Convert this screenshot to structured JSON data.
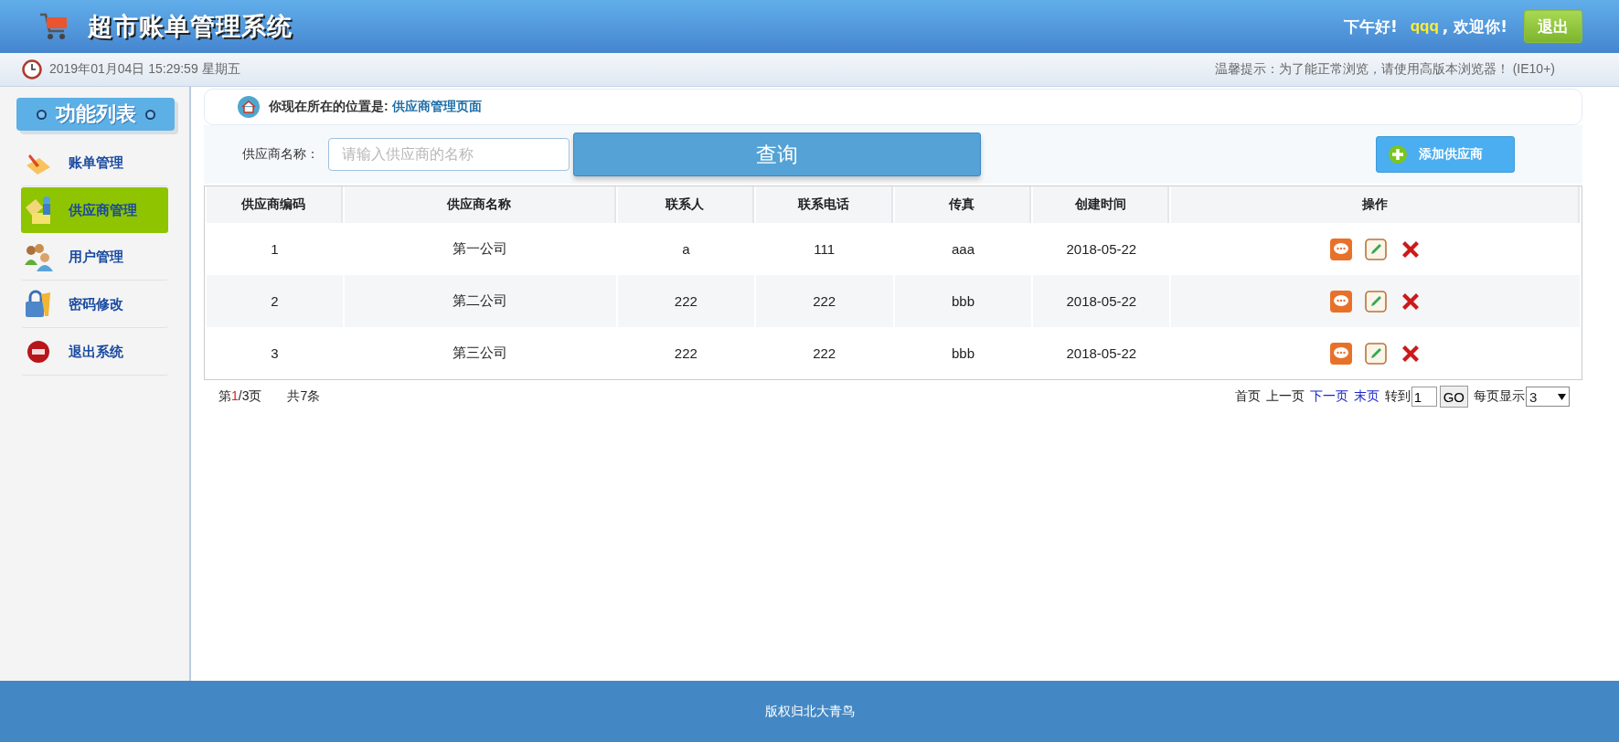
{
  "header": {
    "title": "超市账单管理系统",
    "greeting": "下午好!",
    "username": "qqq",
    "welcome": ", 欢迎你!",
    "logout_button": "退出"
  },
  "info_bar": {
    "datetime": "2019年01月04日 15:29:59 星期五",
    "notice": "温馨提示：为了能正常浏览，请使用高版本浏览器！ (IE10+)"
  },
  "sidebar": {
    "title": "功能列表",
    "items": [
      {
        "kind": "bill",
        "label": "账单管理",
        "selected": false
      },
      {
        "kind": "supplier",
        "label": "供应商管理",
        "selected": true
      },
      {
        "kind": "user",
        "label": "用户管理",
        "selected": false
      },
      {
        "kind": "password",
        "label": "密码修改",
        "selected": false
      },
      {
        "kind": "exit",
        "label": "退出系统",
        "selected": false
      }
    ]
  },
  "breadcrumb": {
    "label": "你现在所在的位置是:",
    "location": "供应商管理页面"
  },
  "search": {
    "label": "供应商名称：",
    "placeholder": "请输入供应商的名称",
    "button": "查询",
    "add_button": "添加供应商"
  },
  "table": {
    "columns": [
      "供应商编码",
      "供应商名称",
      "联系人",
      "联系电话",
      "传真",
      "创建时间",
      "操作"
    ],
    "rows": [
      [
        "1",
        "第一公司",
        "a",
        "111",
        "aaa",
        "2018-05-22"
      ],
      [
        "2",
        "第二公司",
        "222",
        "222",
        "bbb",
        "2018-05-22"
      ],
      [
        "3",
        "第三公司",
        "222",
        "222",
        "bbb",
        "2018-05-22"
      ]
    ]
  },
  "pagination": {
    "page_prefix": "第",
    "current_page": "1",
    "page_suffix": "/3页",
    "total": "共7条",
    "links": [
      {
        "label": "首页",
        "enabled": false
      },
      {
        "label": "上一页",
        "enabled": false
      },
      {
        "label": "下一页",
        "enabled": true
      },
      {
        "label": "末页",
        "enabled": true
      }
    ],
    "jump_label": "转到",
    "jump_value": "1",
    "go_button": "GO",
    "page_size_label": "每页显示",
    "page_size": "3"
  },
  "footer": {
    "copyright": "版权归北大青鸟"
  }
}
